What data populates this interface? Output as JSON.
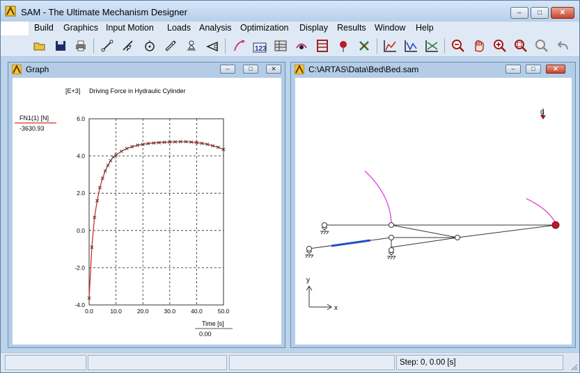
{
  "window": {
    "title": "SAM - The Ultimate Mechanism Designer",
    "minimize": "–",
    "maximize": "□",
    "close": "✕"
  },
  "menu": [
    "Build",
    "Graphics",
    "Input Motion",
    "Loads",
    "Analysis",
    "Optimization",
    "Display",
    "Results",
    "Window",
    "Help"
  ],
  "toolbar_icons": [
    "open-icon",
    "save-icon",
    "print-icon",
    "beam-icon",
    "hinge-icon",
    "slider-icon",
    "gear-icon",
    "ground-icon",
    "spring-icon",
    "motion-icon",
    "numbering-icon",
    "table-icon",
    "lens-icon",
    "ladder-icon",
    "load-icon",
    "windmill-icon",
    "plot-xy-icon",
    "plot-xy-2-icon",
    "plot-xy-3-icon",
    "zoom-out-icon",
    "pan-icon",
    "zoom-in-icon",
    "zoom-window-icon",
    "inspect-icon",
    "undo-icon"
  ],
  "graph_window": {
    "title": "Graph",
    "exponent_label": "[E+3]",
    "chart_title": "Driving Force in Hydraulic Cylinder",
    "legend_label": "FN1(1) [N]",
    "legend_value": "-3630.93",
    "x_axis_label": "Time [s]",
    "x_cursor_value": "0.00"
  },
  "mechanism_window": {
    "title": "C:\\ARTAS\\Data\\Bed\\Bed.sam",
    "axis_y": "y",
    "axis_x": "x",
    "load_label": "g"
  },
  "status": {
    "step_text": "Step: 0,     0.00 [s]"
  },
  "colors": {
    "curve": "#d42a2a",
    "markers": "#333333",
    "trajectory": "#e040e0",
    "actuator": "#2050c0",
    "link": "#333333"
  },
  "chart_data": {
    "type": "line",
    "title": "Driving Force in Hydraulic Cylinder",
    "xlabel": "Time [s]",
    "ylabel": "",
    "xlim": [
      0,
      50
    ],
    "ylim": [
      -4.0,
      6.0
    ],
    "x_ticks": [
      "0.0",
      "10.0",
      "20.0",
      "30.0",
      "40.0",
      "50.0"
    ],
    "y_ticks": [
      "-4.0",
      "-2.0",
      "0.0",
      "2.0",
      "4.0",
      "6.0"
    ],
    "grid": true,
    "series": [
      {
        "name": "FN1(1) [N]",
        "x": [
          0,
          1,
          2,
          3,
          4,
          5,
          6,
          7,
          8,
          9,
          10,
          12,
          14,
          16,
          18,
          20,
          22,
          24,
          26,
          28,
          30,
          32,
          34,
          36,
          38,
          40,
          42,
          44,
          46,
          48,
          50
        ],
        "values": [
          -3.63,
          -0.9,
          0.7,
          1.6,
          2.3,
          2.8,
          3.2,
          3.5,
          3.75,
          3.95,
          4.05,
          4.25,
          4.4,
          4.5,
          4.58,
          4.63,
          4.67,
          4.7,
          4.72,
          4.74,
          4.75,
          4.76,
          4.77,
          4.77,
          4.75,
          4.72,
          4.68,
          4.63,
          4.55,
          4.47,
          4.35
        ]
      }
    ]
  }
}
